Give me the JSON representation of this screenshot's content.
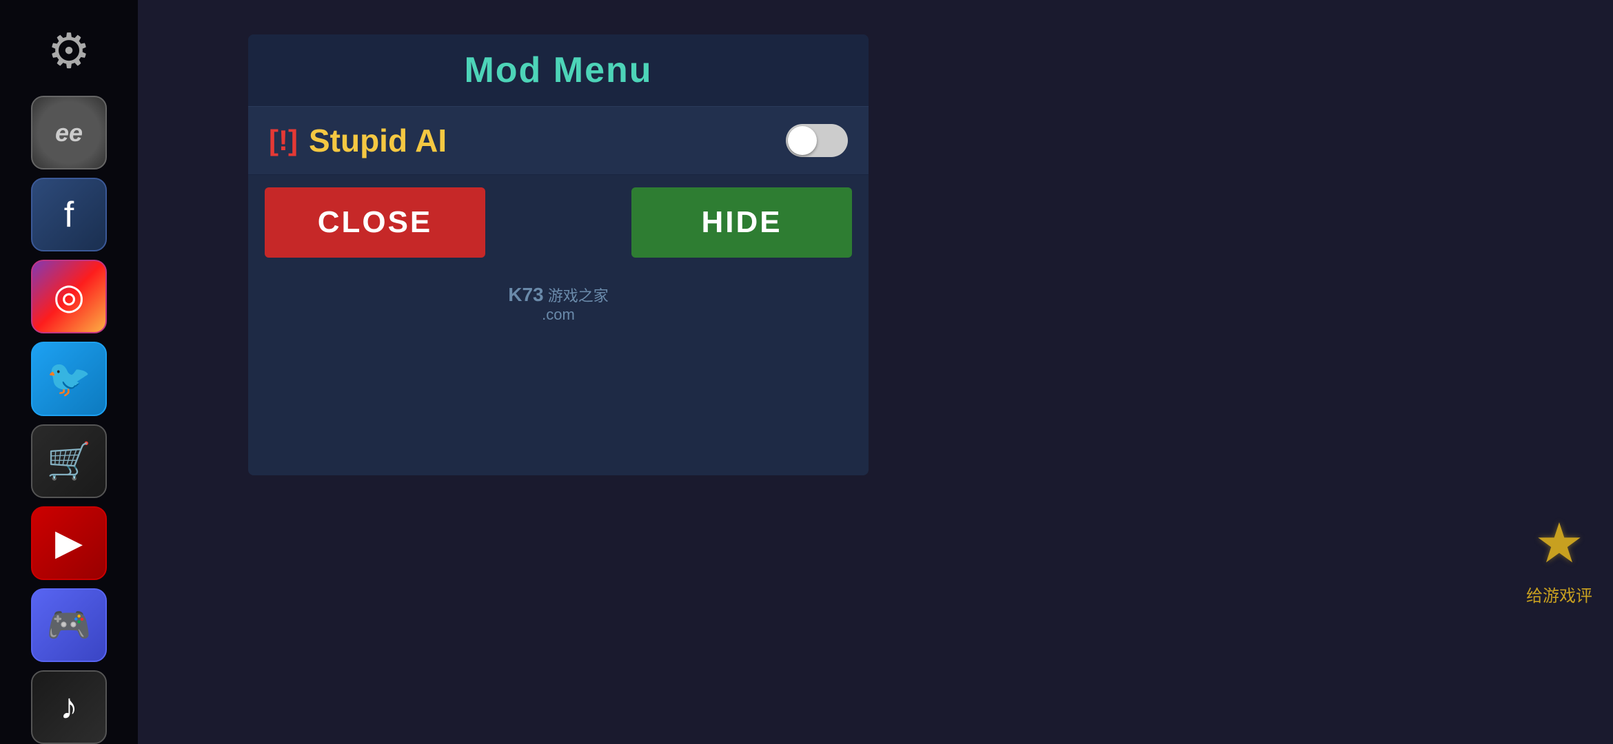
{
  "header": {
    "title": "Mod Menu"
  },
  "mod_item": {
    "warning_symbol": "[!]",
    "name": "Stupid AI",
    "toggle_state": "off"
  },
  "buttons": {
    "close_label": "CLOSE",
    "hide_label": "HIDE"
  },
  "watermark": {
    "brand": "K73",
    "suffix": "游戏之家",
    "domain": ".com"
  },
  "sidebar": {
    "icons": [
      {
        "id": "gear",
        "symbol": "⚙",
        "label": "settings"
      },
      {
        "id": "avatar",
        "symbol": "ee",
        "label": "user-avatar"
      },
      {
        "id": "facebook",
        "symbol": "f",
        "label": "facebook"
      },
      {
        "id": "instagram",
        "symbol": "◎",
        "label": "instagram"
      },
      {
        "id": "twitter",
        "symbol": "🐦",
        "label": "twitter"
      },
      {
        "id": "cart",
        "symbol": "🛒",
        "label": "shop"
      },
      {
        "id": "youtube",
        "symbol": "▶",
        "label": "youtube"
      },
      {
        "id": "discord",
        "symbol": "🎮",
        "label": "discord"
      },
      {
        "id": "tiktok",
        "symbol": "♪",
        "label": "tiktok"
      }
    ]
  },
  "star_rating": {
    "icon": "★",
    "label": "给游戏评"
  },
  "colors": {
    "header_title": "#4dd4b8",
    "warning": "#e53935",
    "mod_name": "#f5c842",
    "close_btn": "#c62828",
    "hide_btn": "#2e7d32"
  }
}
